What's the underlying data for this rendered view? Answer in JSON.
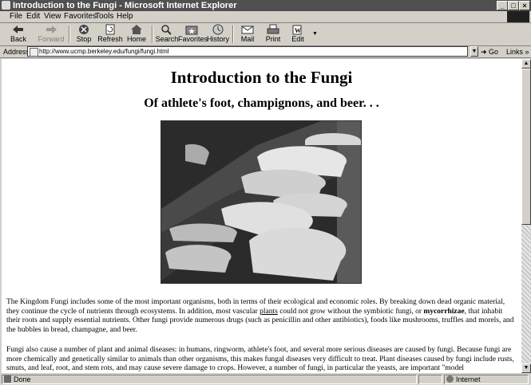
{
  "window": {
    "title": "Introduction to the Fungi - Microsoft Internet Explorer"
  },
  "menu": [
    "File",
    "Edit",
    "View",
    "Favorites",
    "Tools",
    "Help"
  ],
  "toolbar": {
    "back": "Back",
    "forward": "Forward",
    "stop": "Stop",
    "refresh": "Refresh",
    "home": "Home",
    "search": "Search",
    "favorites": "Favorites",
    "history": "History",
    "mail": "Mail",
    "print": "Print",
    "edit": "Edit"
  },
  "address": {
    "label": "Address",
    "url": "http://www.ucmp.berkeley.edu/fungi/fungi.html",
    "go": "Go",
    "links": "Links"
  },
  "page": {
    "title": "Introduction to the Fungi",
    "subtitle": "Of athlete's foot, champignons, and beer. . .",
    "p1a": "The Kingdom Fungi includes some of the most important organisms, both in terms of their ecological and economic roles. By breaking down dead organic material, they continue the cycle of nutrients through ecosystems. In addition, most vascular ",
    "p1link": "plants",
    "p1b": " could not grow without the symbiotic fungi, or ",
    "p1bold": "mycorrhizae",
    "p1c": ", that inhabit their roots and supply essential nutrients. Other fungi provide numerous drugs (such as penicillin and other antibiotics), foods like mushrooms, truffles and morels, and the bubbles in bread, champagne, and beer.",
    "p2": "Fungi also cause a number of plant and animal diseases: in humans, ringworm, athlete's foot, and several more serious diseases are caused by fungi. Because fungi are more chemically and genetically similar to animals than other organisms, this makes fungal diseases very difficult to treat. Plant diseases caused by fungi include rusts, smuts, and leaf, root, and stem rots, and may cause severe damage to crops. However, a number of fungi, in particular the yeasts, are important \"model"
  },
  "status": {
    "left": "Done",
    "zone": "Internet"
  }
}
